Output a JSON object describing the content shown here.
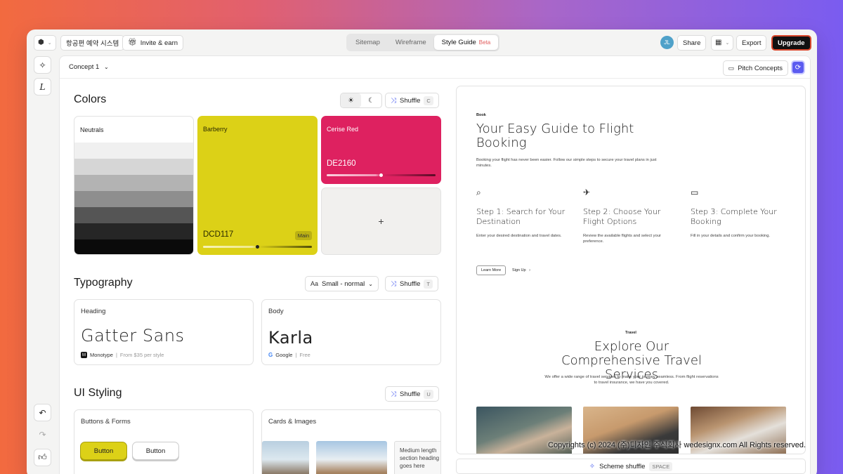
{
  "topbar": {
    "project_name": "항공편 예약 시스템",
    "invite_label": "Invite & earn",
    "tabs": [
      {
        "label": "Sitemap"
      },
      {
        "label": "Wireframe"
      },
      {
        "label": "Style Guide",
        "badge": "Beta"
      }
    ],
    "avatar_initials": "JL",
    "share_label": "Share",
    "export_label": "Export",
    "upgrade_label": "Upgrade"
  },
  "subbar": {
    "concept_label": "Concept 1",
    "pitch_label": "Pitch Concepts"
  },
  "colors": {
    "title": "Colors",
    "shuffle_label": "Shuffle",
    "shuffle_key": "C",
    "neutrals_label": "Neutrals",
    "barberry_label": "Barberry",
    "barberry_hex": "DCD117",
    "barberry_badge": "Main",
    "cerise_label": "Cerise Red",
    "cerise_hex": "DE2160",
    "add_label": "+",
    "swatches": {
      "barberry": "#dcd117",
      "cerise": "#de2160"
    }
  },
  "typography": {
    "title": "Typography",
    "size_label": "Small - normal",
    "shuffle_label": "Shuffle",
    "shuffle_key": "T",
    "heading": {
      "label": "Heading",
      "font": "Gatter Sans",
      "foundry": "Monotype",
      "price": "From $35 per style"
    },
    "body": {
      "label": "Body",
      "font": "Karla",
      "foundry": "Google",
      "price": "Free"
    }
  },
  "ui_styling": {
    "title": "UI Styling",
    "shuffle_label": "Shuffle",
    "shuffle_key": "U",
    "buttons_forms": {
      "label": "Buttons & Forms",
      "primary": "Button",
      "secondary": "Button"
    },
    "cards_images": {
      "label": "Cards & Images",
      "caption": "Medium length section heading goes here"
    }
  },
  "preview": {
    "hero_tag": "Book",
    "hero_title": "Your Easy Guide to Flight Booking",
    "hero_text": "Booking your flight has never been easier. Follow our simple steps to secure your travel plans in just minutes.",
    "steps": [
      {
        "title": "Step 1: Search for Your Destination",
        "text": "Enter your desired destination and travel dates."
      },
      {
        "title": "Step 2: Choose Your Flight Options",
        "text": "Review the available flights and select your preference."
      },
      {
        "title": "Step 3: Complete Your Booking",
        "text": "Fill in your details and confirm your booking."
      }
    ],
    "learn_more": "Learn More",
    "sign_up": "Sign Up",
    "section_tag": "Travel",
    "section_title": "Explore Our Comprehensive Travel Services",
    "section_text": "We offer a wide range of travel services to make your journey seamless. From flight reservations to travel insurance, we have you covered."
  },
  "scheme": {
    "label": "Scheme shuffle",
    "key": "SPACE"
  },
  "watermark": "Copyrights (c) 2024 (주)디자인 주식회사 wedesignx.com All Rights reserved."
}
